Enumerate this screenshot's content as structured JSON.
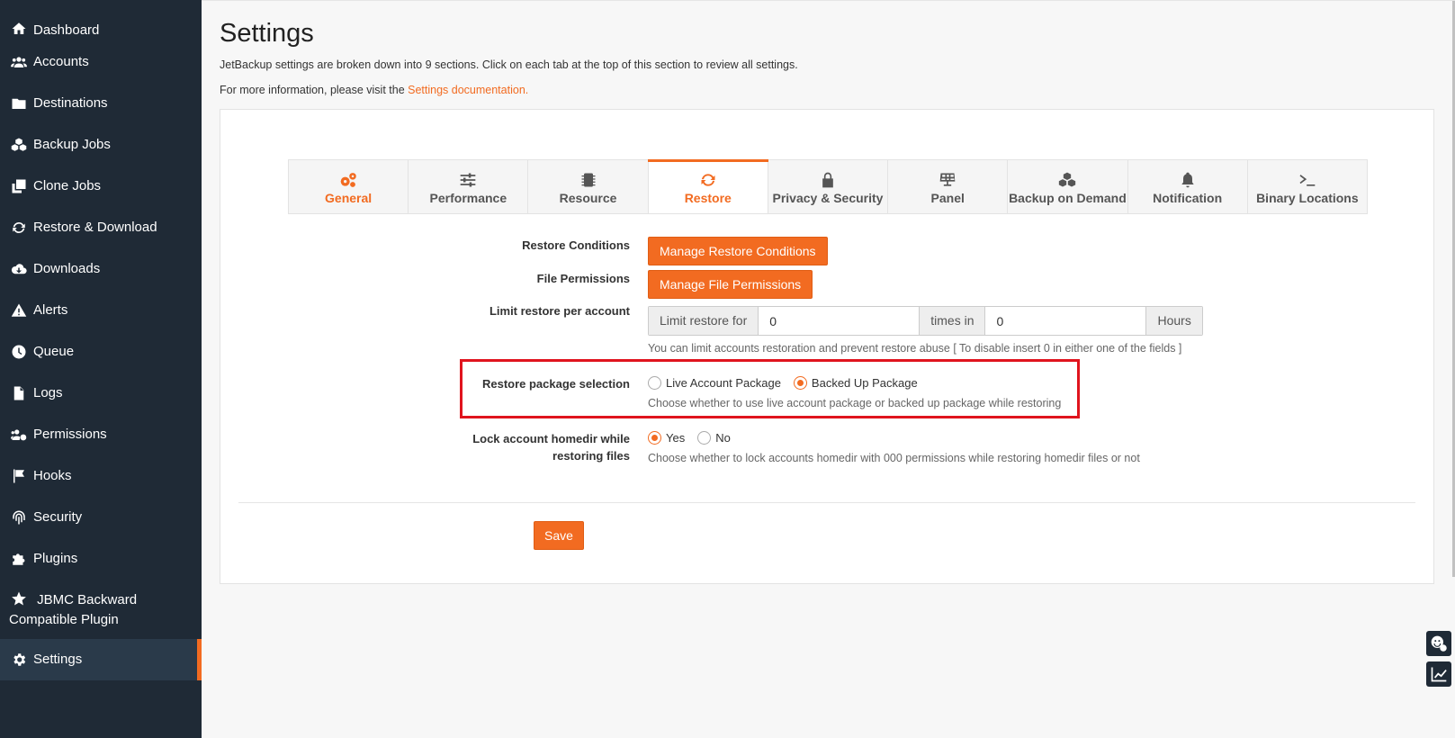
{
  "sidebar": {
    "items": [
      {
        "label": "Dashboard",
        "icon": "home-icon"
      },
      {
        "label": "Accounts",
        "icon": "users-icon"
      },
      {
        "label": "Destinations",
        "icon": "folder-icon"
      },
      {
        "label": "Backup Jobs",
        "icon": "cubes-icon"
      },
      {
        "label": "Clone Jobs",
        "icon": "clone-icon"
      },
      {
        "label": "Restore & Download",
        "icon": "refresh-icon"
      },
      {
        "label": "Downloads",
        "icon": "cloud-download-icon"
      },
      {
        "label": "Alerts",
        "icon": "warning-icon"
      },
      {
        "label": "Queue",
        "icon": "clock-icon"
      },
      {
        "label": "Logs",
        "icon": "file-icon"
      },
      {
        "label": "Permissions",
        "icon": "users-cog-icon"
      },
      {
        "label": "Hooks",
        "icon": "flag-icon"
      },
      {
        "label": "Security",
        "icon": "fingerprint-icon"
      },
      {
        "label": "Plugins",
        "icon": "puzzle-icon"
      },
      {
        "label": "JBMC Backward Compatible Plugin",
        "icon": "star-icon"
      },
      {
        "label": "Settings",
        "icon": "gear-icon",
        "active": true
      }
    ]
  },
  "header": {
    "title": "Settings",
    "description": "JetBackup settings are broken down into 9 sections. Click on each tab at the top of this section to review all settings.",
    "more_info_prefix": "For more information, please visit the ",
    "more_info_link": "Settings documentation."
  },
  "tabs": [
    {
      "label": "General",
      "icon": "gears-icon"
    },
    {
      "label": "Performance",
      "icon": "sliders-icon"
    },
    {
      "label": "Resource",
      "icon": "chip-icon"
    },
    {
      "label": "Restore",
      "icon": "refresh-icon",
      "active": true
    },
    {
      "label": "Privacy & Security",
      "icon": "lock-icon"
    },
    {
      "label": "Panel",
      "icon": "solar-panel-icon"
    },
    {
      "label": "Backup on Demand",
      "icon": "cubes-icon"
    },
    {
      "label": "Notification",
      "icon": "bell-icon"
    },
    {
      "label": "Binary Locations",
      "icon": "terminal-icon"
    }
  ],
  "form": {
    "restore_conditions": {
      "label": "Restore Conditions",
      "button": "Manage Restore Conditions"
    },
    "file_permissions": {
      "label": "File Permissions",
      "button": "Manage File Permissions"
    },
    "limit_restore": {
      "label": "Limit restore per account",
      "prefix": "Limit restore for",
      "value1": "0",
      "middle": "times in",
      "value2": "0",
      "suffix": "Hours",
      "help": "You can limit accounts restoration and prevent restore abuse [ To disable insert 0 in either one of the fields ]"
    },
    "package_selection": {
      "label": "Restore package selection",
      "option1": "Live Account Package",
      "option2": "Backed Up Package",
      "selected": "Backed Up Package",
      "help": "Choose whether to use live account package or backed up package while restoring"
    },
    "lock_homedir": {
      "label_line1": "Lock account homedir while",
      "label_line2": "restoring files",
      "option1": "Yes",
      "option2": "No",
      "selected": "Yes",
      "help": "Choose whether to lock accounts homedir with 000 permissions while restoring homedir files or not"
    },
    "save": "Save"
  },
  "colors": {
    "accent": "#f26b21",
    "sidebar": "#1f2a36",
    "highlight": "#e0141e"
  }
}
